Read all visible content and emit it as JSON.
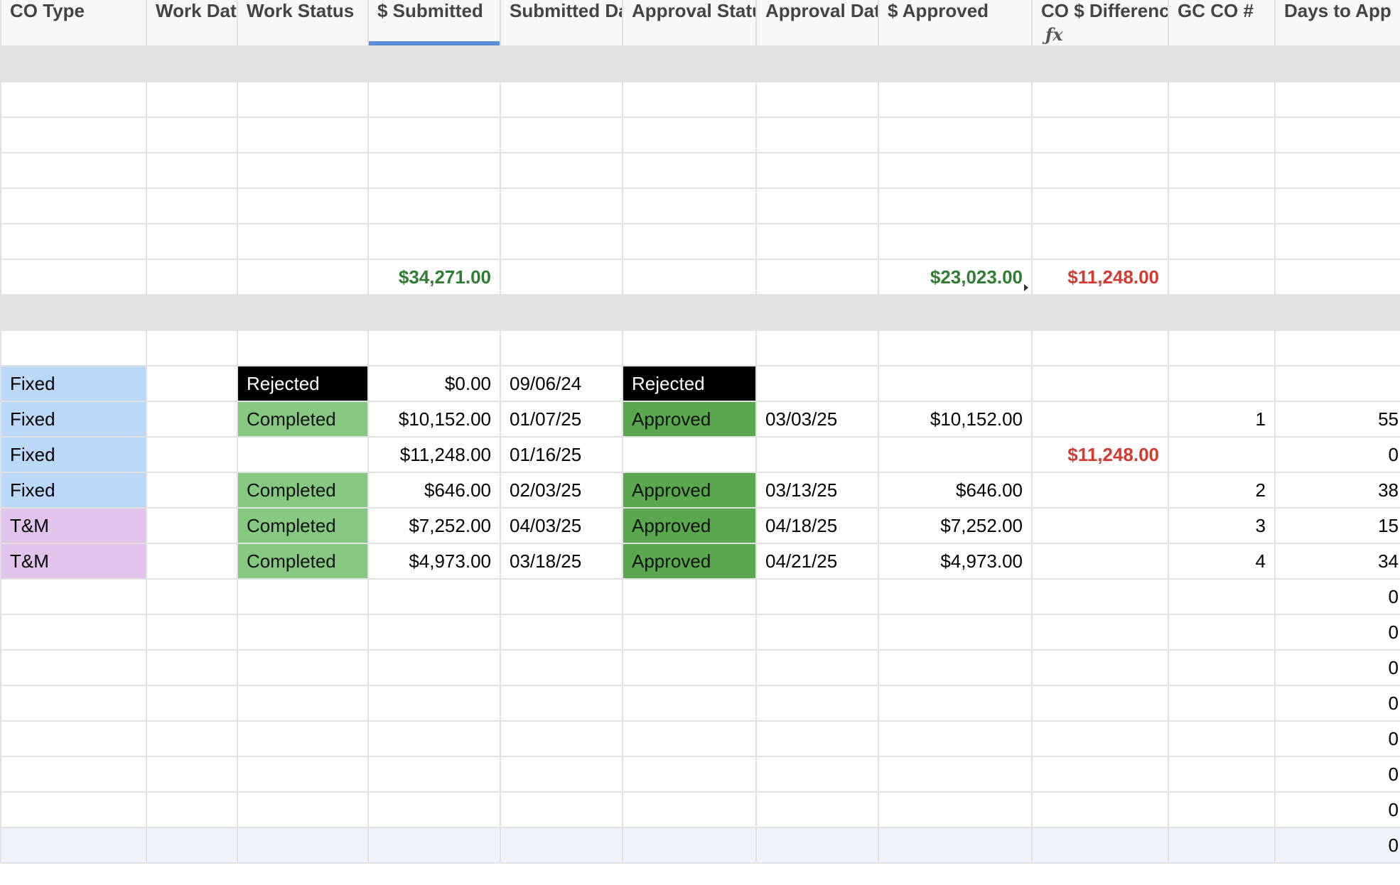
{
  "columns": [
    "CO Type",
    "Work Date",
    "Work Status",
    "$ Submitted",
    "Submitted Date",
    "Approval Status",
    "Approval Date",
    "$ Approved",
    "CO $ Difference",
    "GC CO #",
    "Days to App"
  ],
  "formula_icon": "ƒx",
  "totals": {
    "submitted": "$34,271.00",
    "approved": "$23,023.00",
    "difference": "$11,248.00"
  },
  "rows": [
    {
      "type": "Fixed",
      "work_status": "Rejected",
      "submitted": "$0.00",
      "submitted_date": "09/06/24",
      "approval_status": "Rejected",
      "approval_date": "",
      "approved": "",
      "difference": "",
      "gc_co": "",
      "days": ""
    },
    {
      "type": "Fixed",
      "work_status": "Completed",
      "submitted": "$10,152.00",
      "submitted_date": "01/07/25",
      "approval_status": "Approved",
      "approval_date": "03/03/25",
      "approved": "$10,152.00",
      "difference": "",
      "gc_co": "1",
      "days": "55"
    },
    {
      "type": "Fixed",
      "work_status": "",
      "submitted": "$11,248.00",
      "submitted_date": "01/16/25",
      "approval_status": "",
      "approval_date": "",
      "approved": "",
      "difference": "$11,248.00",
      "gc_co": "",
      "days": "0"
    },
    {
      "type": "Fixed",
      "work_status": "Completed",
      "submitted": "$646.00",
      "submitted_date": "02/03/25",
      "approval_status": "Approved",
      "approval_date": "03/13/25",
      "approved": "$646.00",
      "difference": "",
      "gc_co": "2",
      "days": "38"
    },
    {
      "type": "T&M",
      "work_status": "Completed",
      "submitted": "$7,252.00",
      "submitted_date": "04/03/25",
      "approval_status": "Approved",
      "approval_date": "04/18/25",
      "approved": "$7,252.00",
      "difference": "",
      "gc_co": "3",
      "days": "15"
    },
    {
      "type": "T&M",
      "work_status": "Completed",
      "submitted": "$4,973.00",
      "submitted_date": "03/18/25",
      "approval_status": "Approved",
      "approval_date": "04/21/25",
      "approved": "$4,973.00",
      "difference": "",
      "gc_co": "4",
      "days": "34"
    }
  ],
  "trailing_days": [
    "0",
    "0",
    "0",
    "0",
    "0",
    "0",
    "0",
    "0"
  ],
  "colors": {
    "header_bg": "#f8f8f6",
    "group_bg": "#e2e2e2",
    "fixed_bg": "#bcd8f8",
    "tm_bg": "#e2c3eb",
    "completed_bg": "#86c882",
    "approved_bg": "#5aa84d",
    "rejected_bg": "#000000",
    "positive_text": "#2f7d32",
    "negative_text": "#d33b30"
  }
}
